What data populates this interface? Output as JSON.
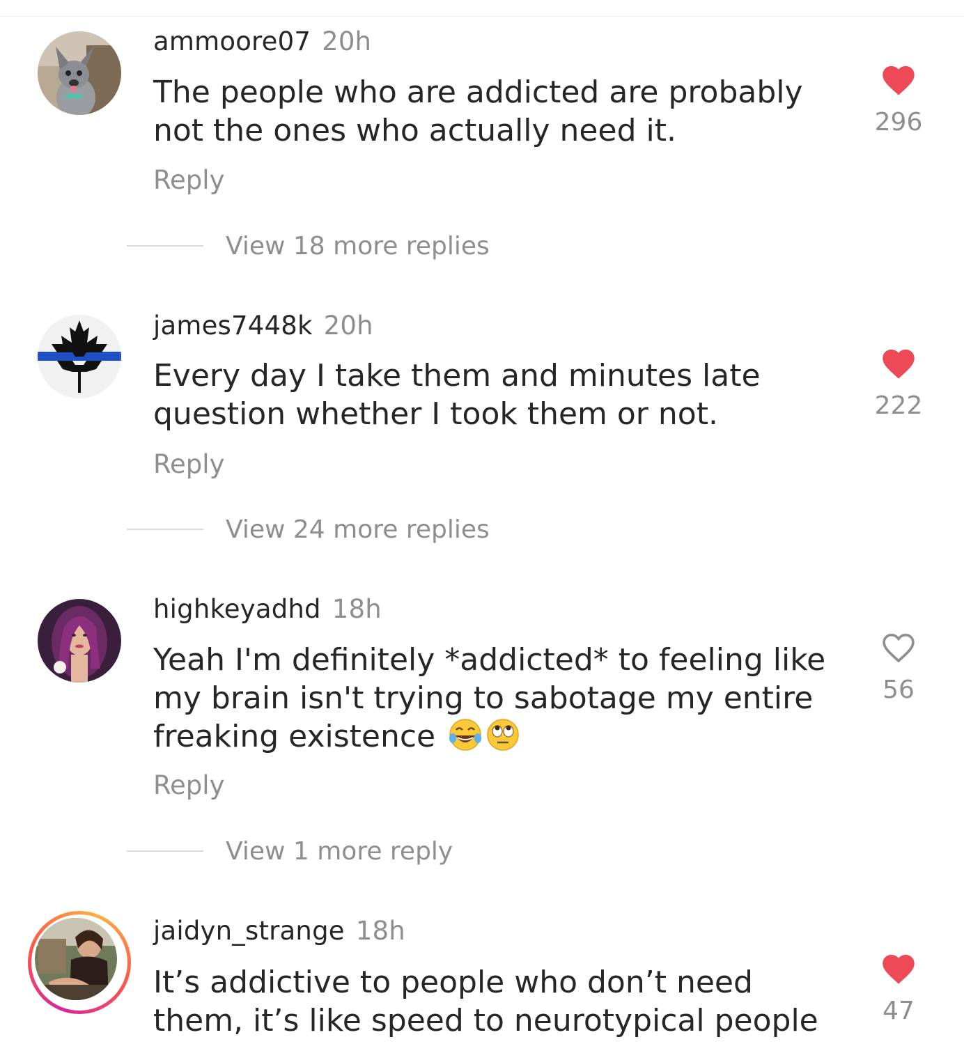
{
  "comments": [
    {
      "username": "ammoore07",
      "time": "20h",
      "text": "The people who are addicted are probably not the ones who actually need it.",
      "reply_label": "Reply",
      "view_more": "View 18 more replies",
      "likes": "296",
      "liked": true,
      "avatar": "dog-photo"
    },
    {
      "username": "james7448k",
      "time": "20h",
      "text": "Every day I take them and minutes late question whether I took them or not.",
      "reply_label": "Reply",
      "view_more": "View 24 more replies",
      "likes": "222",
      "liked": true,
      "avatar": "maple-leaf-thin-blue-line"
    },
    {
      "username": "highkeyadhd",
      "time": "18h",
      "text": "Yeah I'm definitely *addicted* to feeling like my brain isn't trying to sabotage my entire freaking existence",
      "emojis": [
        "tears-of-joy-emoji",
        "eye-roll-emoji"
      ],
      "reply_label": "Reply",
      "view_more": "View 1 more reply",
      "likes": "56",
      "liked": false,
      "avatar": "woman-purple-hair-photo"
    },
    {
      "username": "jaidyn_strange",
      "time": "18h",
      "text": "It’s addictive to people who don’t need them, it’s like speed to neurotypical people",
      "likes": "47",
      "liked": true,
      "avatar": "person-outdoor-photo",
      "has_story_ring": true
    }
  ],
  "colors": {
    "text": "#262626",
    "secondary": "#8e8e8e",
    "like_red": "#ed4956",
    "divider": "#dbdbdb"
  }
}
